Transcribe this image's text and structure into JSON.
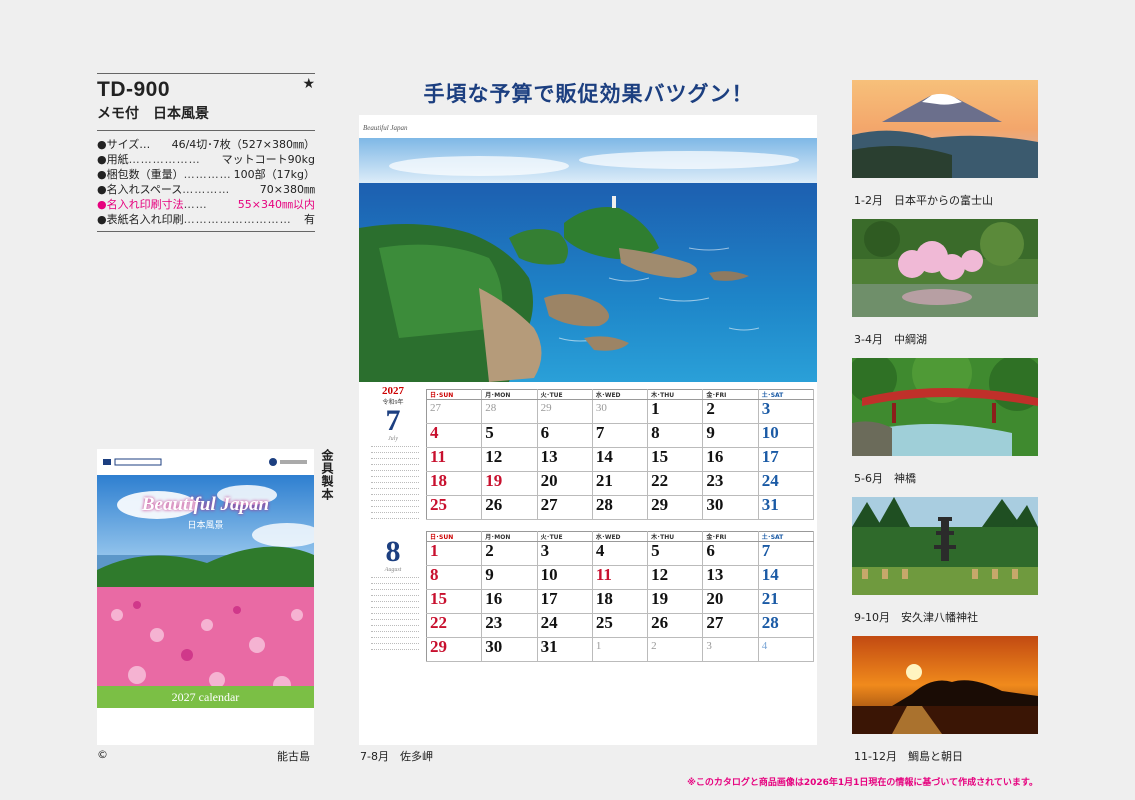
{
  "product": {
    "model": "TD-900",
    "star": "★",
    "subtitle": "メモ付　日本風景",
    "specs": [
      {
        "label": "●サイズ…",
        "dots": "",
        "value": "46/4切･7枚（527×380㎜）",
        "highlight": false
      },
      {
        "label": "●用紙",
        "dots": "………………",
        "value": "マットコート90kg",
        "highlight": false
      },
      {
        "label": "●梱包数（重量）",
        "dots": "…………",
        "value": "100部（17kg）",
        "highlight": false
      },
      {
        "label": "●名入れスペース",
        "dots": "…………",
        "value": "70×380㎜",
        "highlight": false
      },
      {
        "label": "●名入れ印刷寸法",
        "dots": "……",
        "value": "55×340㎜以内",
        "highlight": true
      },
      {
        "label": "●表紙名入れ印刷",
        "dots": "………………………",
        "value": "有",
        "highlight": false
      }
    ]
  },
  "cover": {
    "script_title": "Beautiful Japan",
    "jp_title": "日本風景",
    "bottom_label": "2027 calendar",
    "side_label": "金具製本",
    "caption": "能古島",
    "copyright": "©"
  },
  "headline": "手頃な予算で販促効果バツグン！",
  "main_calendar": {
    "brand": "Beautiful Japan",
    "caption": "7-8月　佐多岬",
    "weekday_headers": [
      "日･SUN",
      "月･MON",
      "火･TUE",
      "水･WED",
      "木･THU",
      "金･FRI",
      "土･SAT"
    ],
    "months": [
      {
        "year": "2027",
        "era": "令和9年",
        "number": "7",
        "english": "July",
        "weeks": [
          [
            "27",
            "28",
            "29",
            "30",
            "1",
            "2",
            "3"
          ],
          [
            "4",
            "5",
            "6",
            "7",
            "8",
            "9",
            "10"
          ],
          [
            "11",
            "12",
            "13",
            "14",
            "15",
            "16",
            "17"
          ],
          [
            "18",
            "19",
            "20",
            "21",
            "22",
            "23",
            "24"
          ],
          [
            "25",
            "26",
            "27",
            "28",
            "29",
            "30",
            "31"
          ]
        ],
        "outside": [
          [
            true,
            true,
            true,
            true,
            false,
            false,
            false
          ]
        ],
        "holidays": [
          "19"
        ]
      },
      {
        "year": "",
        "era": "",
        "number": "8",
        "english": "August",
        "weeks": [
          [
            "1",
            "2",
            "3",
            "4",
            "5",
            "6",
            "7"
          ],
          [
            "8",
            "9",
            "10",
            "11",
            "12",
            "13",
            "14"
          ],
          [
            "15",
            "16",
            "17",
            "18",
            "19",
            "20",
            "21"
          ],
          [
            "22",
            "23",
            "24",
            "25",
            "26",
            "27",
            "28"
          ],
          [
            "29",
            "30",
            "31",
            "1",
            "2",
            "3",
            "4"
          ]
        ],
        "outside_last_row": [
          false,
          false,
          false,
          true,
          true,
          true,
          true
        ],
        "holidays": [
          "11"
        ]
      }
    ]
  },
  "thumbnails": [
    {
      "caption": "1-2月　日本平からの富士山"
    },
    {
      "caption": "3-4月　中綱湖"
    },
    {
      "caption": "5-6月　神橋"
    },
    {
      "caption": "9-10月　安久津八幡神社"
    },
    {
      "caption": "11-12月　鯛島と朝日"
    }
  ],
  "footnote": "※このカタログと商品画像は2026年1月1日現在の情報に基づいて作成されています。"
}
